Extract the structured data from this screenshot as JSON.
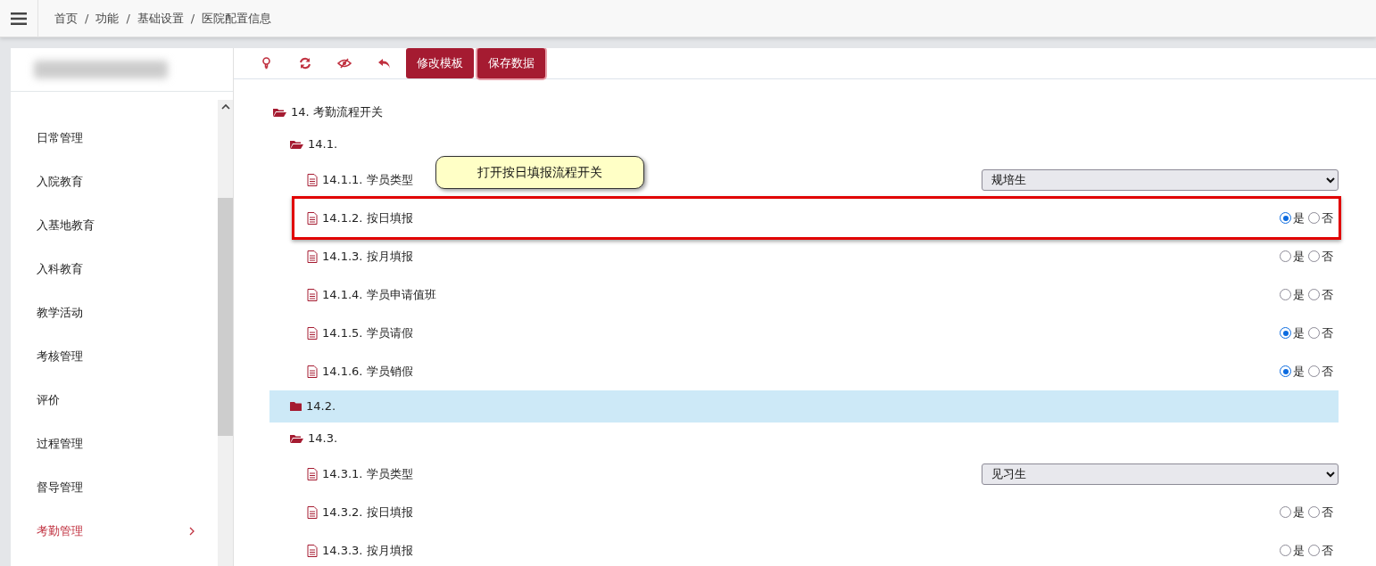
{
  "breadcrumb": {
    "separator": "/",
    "items": [
      "首页",
      "功能",
      "基础设置",
      "医院配置信息"
    ]
  },
  "sidebar": {
    "items": [
      {
        "label": "日常管理",
        "selected": false
      },
      {
        "label": "入院教育",
        "selected": false
      },
      {
        "label": "入基地教育",
        "selected": false
      },
      {
        "label": "入科教育",
        "selected": false
      },
      {
        "label": "教学活动",
        "selected": false
      },
      {
        "label": "考核管理",
        "selected": false
      },
      {
        "label": "评价",
        "selected": false
      },
      {
        "label": "过程管理",
        "selected": false
      },
      {
        "label": "督导管理",
        "selected": false
      },
      {
        "label": "考勤管理",
        "selected": true
      }
    ]
  },
  "toolbar": {
    "buttons": [
      "修改模板",
      "保存数据"
    ]
  },
  "callout": {
    "text": "打开按日填报流程开关"
  },
  "tree": [
    {
      "label": "14. 考勤流程开关",
      "kind": "folder",
      "expanded": true,
      "selected": false,
      "children": [
        {
          "label": "14.1.",
          "kind": "folder",
          "expanded": true,
          "selected": false,
          "children": [
            {
              "label": "14.1.1. 学员类型",
              "kind": "select",
              "value": "规培生",
              "highlighted": false
            },
            {
              "label": "14.1.2. 按日填报",
              "kind": "radio",
              "highlighted": true,
              "options": [
                {
                  "label": "是",
                  "selected": true
                },
                {
                  "label": "否",
                  "selected": false
                }
              ]
            },
            {
              "label": "14.1.3. 按月填报",
              "kind": "radio",
              "highlighted": false,
              "options": [
                {
                  "label": "是",
                  "selected": false
                },
                {
                  "label": "否",
                  "selected": false
                }
              ]
            },
            {
              "label": "14.1.4. 学员申请值班",
              "kind": "radio",
              "highlighted": false,
              "options": [
                {
                  "label": "是",
                  "selected": false
                },
                {
                  "label": "否",
                  "selected": false
                }
              ]
            },
            {
              "label": "14.1.5. 学员请假",
              "kind": "radio",
              "highlighted": false,
              "options": [
                {
                  "label": "是",
                  "selected": true
                },
                {
                  "label": "否",
                  "selected": false
                }
              ]
            },
            {
              "label": "14.1.6. 学员销假",
              "kind": "radio",
              "highlighted": false,
              "options": [
                {
                  "label": "是",
                  "selected": true
                },
                {
                  "label": "否",
                  "selected": false
                }
              ]
            }
          ]
        },
        {
          "label": "14.2.",
          "kind": "folder",
          "expanded": false,
          "selected": true
        },
        {
          "label": "14.3.",
          "kind": "folder",
          "expanded": true,
          "selected": false,
          "children": [
            {
              "label": "14.3.1. 学员类型",
              "kind": "select",
              "value": "见习生",
              "highlighted": false
            },
            {
              "label": "14.3.2. 按日填报",
              "kind": "radio",
              "highlighted": false,
              "options": [
                {
                  "label": "是",
                  "selected": false
                },
                {
                  "label": "否",
                  "selected": false
                }
              ]
            },
            {
              "label": "14.3.3. 按月填报",
              "kind": "radio",
              "highlighted": false,
              "options": [
                {
                  "label": "是",
                  "selected": false
                },
                {
                  "label": "否",
                  "selected": false
                }
              ]
            }
          ]
        }
      ]
    }
  ]
}
